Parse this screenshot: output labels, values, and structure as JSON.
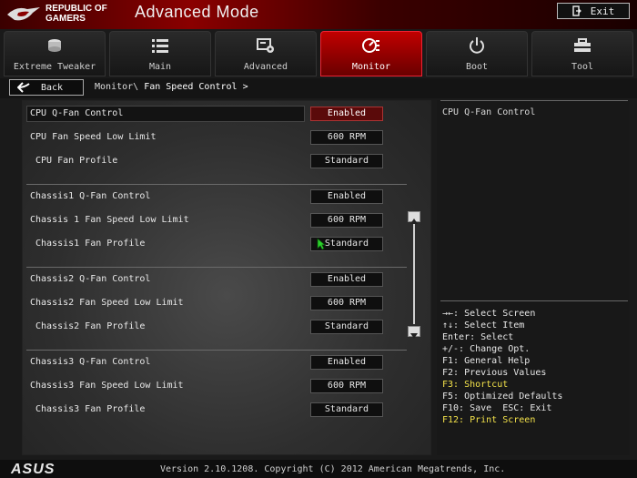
{
  "header": {
    "logo_line1": "REPUBLIC OF",
    "logo_line2": "GAMERS",
    "title": "Advanced Mode",
    "exit_label": "Exit"
  },
  "tabs": [
    {
      "label": "Extreme Tweaker",
      "icon": "tweaker-icon"
    },
    {
      "label": "Main",
      "icon": "list-icon"
    },
    {
      "label": "Advanced",
      "icon": "advanced-icon"
    },
    {
      "label": "Monitor",
      "icon": "monitor-icon",
      "active": true
    },
    {
      "label": "Boot",
      "icon": "power-icon"
    },
    {
      "label": "Tool",
      "icon": "tool-icon"
    }
  ],
  "nav": {
    "back_label": "Back",
    "breadcrumb_parent": "Monitor\\",
    "breadcrumb_current": "Fan Speed Control >"
  },
  "settings": [
    {
      "label": "CPU Q-Fan Control",
      "value": "Enabled"
    },
    {
      "label": "CPU Fan Speed Low Limit",
      "value": "600 RPM"
    },
    {
      "label": "CPU Fan Profile",
      "value": "Standard"
    },
    {
      "label": "Chassis1 Q-Fan Control",
      "value": "Enabled"
    },
    {
      "label": "Chassis 1 Fan Speed Low Limit",
      "value": "600 RPM"
    },
    {
      "label": "Chassis1 Fan Profile",
      "value": "Standard"
    },
    {
      "label": "Chassis2 Q-Fan Control",
      "value": "Enabled"
    },
    {
      "label": "Chassis2 Fan Speed Low Limit",
      "value": "600 RPM"
    },
    {
      "label": "Chassis2 Fan Profile",
      "value": "Standard"
    },
    {
      "label": "Chassis3 Q-Fan Control",
      "value": "Enabled"
    },
    {
      "label": "Chassis3 Fan Speed Low Limit",
      "value": "600 RPM"
    },
    {
      "label": "Chassis3 Fan Profile",
      "value": "Standard"
    }
  ],
  "help": {
    "title": "CPU Q-Fan Control",
    "keys": [
      "→←: Select Screen",
      "↑↓: Select Item",
      "Enter: Select",
      "+/-: Change Opt.",
      "F1: General Help",
      "F2: Previous Values",
      "F3: Shortcut",
      "F5: Optimized Defaults",
      "F10: Save  ESC: Exit",
      "F12: Print Screen"
    ]
  },
  "footer": {
    "brand": "ASUS",
    "version": "Version 2.10.1208. Copyright (C) 2012 American Megatrends, Inc."
  },
  "colors": {
    "accent_red": "#c00000",
    "highlight_yellow": "#f2e14a"
  }
}
